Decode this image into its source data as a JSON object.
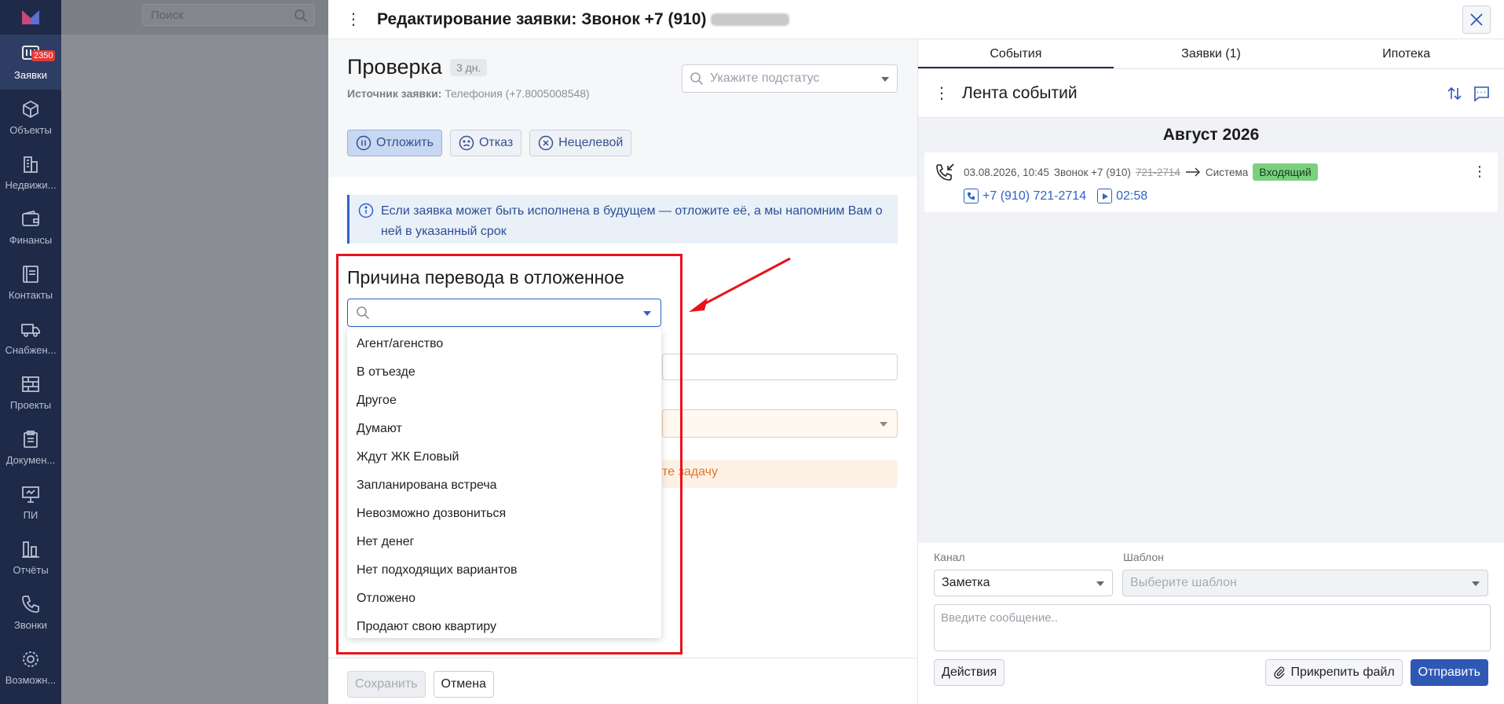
{
  "sidebar": {
    "items": [
      {
        "label": "Заявки",
        "icon": "requests-icon",
        "badge": "2350",
        "active": true
      },
      {
        "label": "Объекты",
        "icon": "cube-icon"
      },
      {
        "label": "Недвижи...",
        "icon": "building-icon"
      },
      {
        "label": "Финансы",
        "icon": "wallet-icon"
      },
      {
        "label": "Контакты",
        "icon": "contacts-icon"
      },
      {
        "label": "Снабжен...",
        "icon": "truck-icon"
      },
      {
        "label": "Проекты",
        "icon": "brick-icon"
      },
      {
        "label": "Докумен...",
        "icon": "clipboard-icon"
      },
      {
        "label": "ПИ",
        "icon": "presentation-icon"
      },
      {
        "label": "Отчёты",
        "icon": "reports-icon"
      },
      {
        "label": "Звонки",
        "icon": "phone-icon"
      },
      {
        "label": "Возможн...",
        "icon": "gear-icon"
      }
    ]
  },
  "background": {
    "search_placeholder": "Поиск"
  },
  "modal": {
    "title": "Редактирование заявки: Звонок +7 (910)",
    "status": {
      "title": "Проверка",
      "days": "3 дн.",
      "source_label": "Источник заявки:",
      "source_value": "Телефония (+7.8005008548)",
      "substatus_placeholder": "Укажите подстатус"
    },
    "actions": {
      "postpone": "Отложить",
      "reject": "Отказ",
      "nontarget": "Нецелевой"
    },
    "info": "Если заявка может быть исполнена в будущем — отложите её, а мы напомним Вам о ней в указанный срок",
    "task_link": "те задачу",
    "reason": {
      "title": "Причина перевода в отложенное",
      "options": [
        "Агент/агенство",
        "В отъезде",
        "Другое",
        "Думают",
        "Ждут ЖК Еловый",
        "Запланирована встреча",
        "Невозможно дозвониться",
        "Нет денег",
        "Нет подходящих вариантов",
        "Отложено",
        "Продают свою квартиру"
      ]
    },
    "footer": {
      "save": "Сохранить",
      "cancel": "Отмена"
    }
  },
  "right": {
    "tabs": [
      "События",
      "Заявки (1)",
      "Ипотека"
    ],
    "feed_title": "Лента событий",
    "month": "Август 2026",
    "event": {
      "datetime": "03.08.2026, 10:45",
      "desc": "Звонок +7 (910)",
      "desc_hidden": "721-2714",
      "target": "Система",
      "tag": "Входящий",
      "phone": "+7 (910) 721-2714",
      "duration": "02:58"
    },
    "composer": {
      "channel_label": "Канал",
      "template_label": "Шаблон",
      "channel_value": "Заметка",
      "template_placeholder": "Выберите шаблон",
      "message_placeholder": "Введите сообщение..",
      "actions": "Действия",
      "attach": "Прикрепить файл",
      "send": "Отправить"
    }
  },
  "colors": {
    "accent": "#2f58b5",
    "highlight": "#e8131a",
    "sidebar": "#1e2a47",
    "tag": "#7bd07f"
  }
}
